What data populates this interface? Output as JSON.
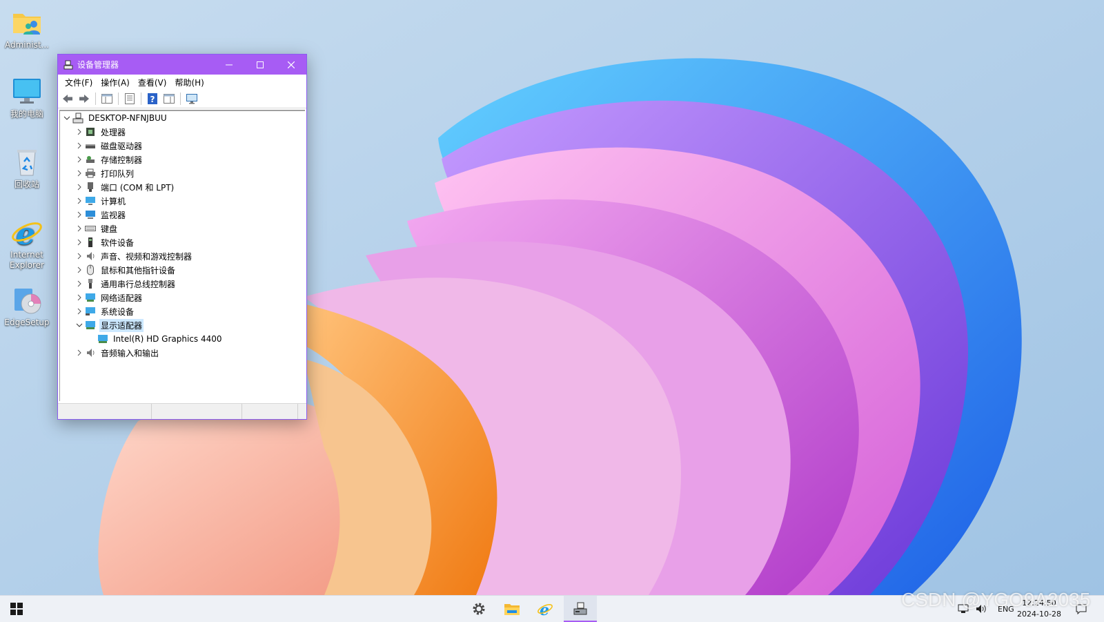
{
  "desktop": {
    "icons": [
      {
        "label": "Administ...",
        "icon": "user-folder-icon"
      },
      {
        "label": "我的电脑",
        "icon": "monitor-icon"
      },
      {
        "label": "回收站",
        "icon": "recycle-bin-icon"
      },
      {
        "label": "Internet Explorer",
        "icon": "ie-icon"
      },
      {
        "label": "EdgeSetup",
        "icon": "setup-disc-icon"
      }
    ]
  },
  "window": {
    "title": "设备管理器",
    "controls": {
      "minimize": "minimize-icon",
      "maximize": "maximize-icon",
      "close": "close-icon"
    },
    "menu": [
      "文件(F)",
      "操作(A)",
      "查看(V)",
      "帮助(H)"
    ],
    "toolbar": [
      "back-icon",
      "forward-icon",
      "show-hide-tree-icon",
      "properties-icon",
      "help-icon",
      "action-pane-icon",
      "scan-hardware-icon"
    ],
    "tree": {
      "root": "DESKTOP-NFNJBUU",
      "categories": [
        {
          "label": "处理器",
          "icon": "processor-icon"
        },
        {
          "label": "磁盘驱动器",
          "icon": "disk-drive-icon"
        },
        {
          "label": "存储控制器",
          "icon": "storage-controller-icon"
        },
        {
          "label": "打印队列",
          "icon": "printer-icon"
        },
        {
          "label": "端口 (COM 和 LPT)",
          "icon": "port-icon"
        },
        {
          "label": "计算机",
          "icon": "computer-icon"
        },
        {
          "label": "监视器",
          "icon": "monitor-icon"
        },
        {
          "label": "键盘",
          "icon": "keyboard-icon"
        },
        {
          "label": "软件设备",
          "icon": "software-device-icon"
        },
        {
          "label": "声音、视频和游戏控制器",
          "icon": "speaker-icon"
        },
        {
          "label": "鼠标和其他指针设备",
          "icon": "mouse-icon"
        },
        {
          "label": "通用串行总线控制器",
          "icon": "usb-icon"
        },
        {
          "label": "网络适配器",
          "icon": "network-adapter-icon"
        },
        {
          "label": "系统设备",
          "icon": "system-device-icon"
        },
        {
          "label": "显示适配器",
          "icon": "display-adapter-icon",
          "expanded": true,
          "selected": true,
          "children": [
            "Intel(R) HD Graphics 4400"
          ]
        },
        {
          "label": "音频输入和输出",
          "icon": "audio-io-icon"
        }
      ]
    }
  },
  "taskbar": {
    "start": "windows-start-icon",
    "pinned": [
      "settings-gear-icon",
      "file-explorer-icon",
      "ie-icon",
      "device-manager-icon"
    ],
    "tray": {
      "network": "network-icon",
      "volume": "volume-icon",
      "language": "ENG",
      "notification": "notification-icon"
    },
    "time": "12:24:50",
    "date": "2024-10-28"
  },
  "watermark": "CSDN @YGO9A2035",
  "colors": {
    "accent": "#a75cf4",
    "selection": "#cce8ff"
  }
}
